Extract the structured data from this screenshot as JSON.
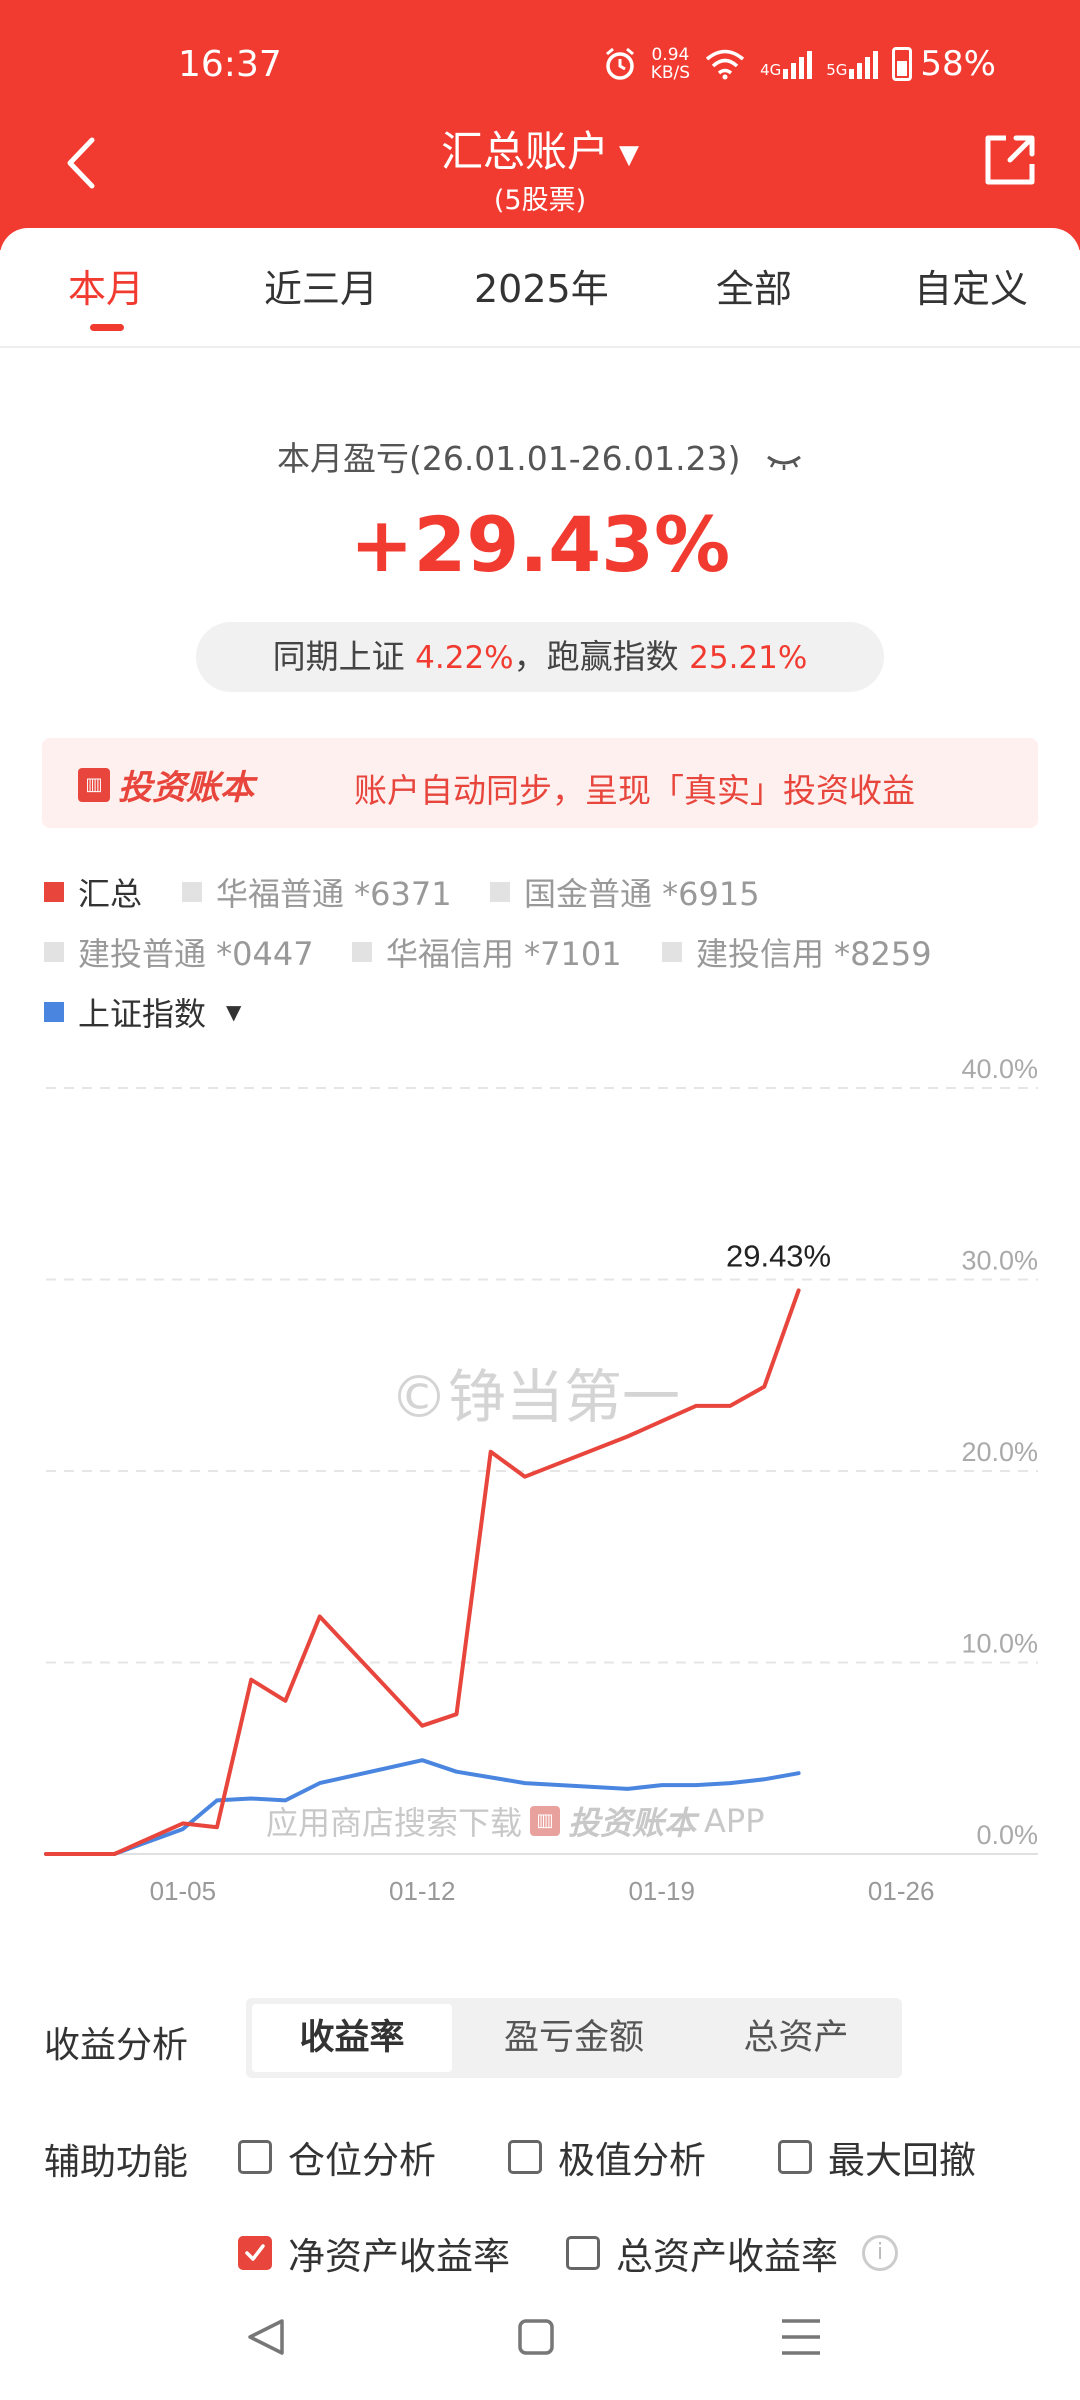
{
  "status": {
    "time": "16:37",
    "net_speed": "0.94",
    "net_unit": "KB/S",
    "sig1": "4G",
    "sig2": "5G",
    "battery": "58%"
  },
  "header": {
    "title": "汇总账户",
    "subtitle": "(5股票)"
  },
  "tabs": [
    "本月",
    "近三月",
    "2025年",
    "全部",
    "自定义"
  ],
  "summary": {
    "period": "本月盈亏(26.01.01-26.01.23)",
    "return": "+29.43%",
    "compare_prefix": "同期上证 ",
    "index_return": "4.22%",
    "compare_mid": "，跑赢指数 ",
    "beat_index": "25.21%"
  },
  "promo": {
    "logo_text": "投资账本",
    "text": "账户自动同步，呈现「真实」投资收益"
  },
  "legend": [
    {
      "label": "汇总",
      "color": "#e8453c",
      "active": true
    },
    {
      "label": "华福普通 *6371",
      "color": "#e2e2e2",
      "active": false
    },
    {
      "label": "国金普通 *6915",
      "color": "#e2e2e2",
      "active": false
    },
    {
      "label": "建投普通 *0447",
      "color": "#e2e2e2",
      "active": false
    },
    {
      "label": "华福信用 *7101",
      "color": "#e2e2e2",
      "active": false
    },
    {
      "label": "建投信用 *8259",
      "color": "#e2e2e2",
      "active": false
    },
    {
      "label": "上证指数",
      "color": "#4a86e0",
      "active": true
    }
  ],
  "chart_data": {
    "type": "line",
    "y_ticks": [
      "40.0%",
      "30.0%",
      "20.0%",
      "10.0%",
      "0.0%"
    ],
    "ylim": [
      0,
      40
    ],
    "x_ticks": [
      "01-05",
      "01-12",
      "01-19",
      "01-26"
    ],
    "x_tick_days": [
      5,
      12,
      19,
      26
    ],
    "xlim": [
      1,
      30
    ],
    "last_label": "29.43%",
    "grid": true,
    "series": [
      {
        "name": "汇总",
        "color": "#e8453c",
        "x": [
          1,
          3,
          5,
          6,
          7,
          8,
          9,
          12,
          13,
          14,
          15,
          18,
          19,
          20,
          21,
          22,
          23
        ],
        "y": [
          0.0,
          0.0,
          1.6,
          1.4,
          9.1,
          8.0,
          12.4,
          6.7,
          7.3,
          21.0,
          19.7,
          21.8,
          22.6,
          23.4,
          23.4,
          24.4,
          29.43
        ]
      },
      {
        "name": "上证指数",
        "color": "#4a86e0",
        "x": [
          1,
          3,
          5,
          6,
          7,
          8,
          9,
          12,
          13,
          14,
          15,
          18,
          19,
          20,
          21,
          22,
          23
        ],
        "y": [
          0.0,
          0.0,
          1.3,
          2.8,
          2.9,
          2.8,
          3.7,
          4.9,
          4.3,
          4.0,
          3.7,
          3.4,
          3.6,
          3.6,
          3.7,
          3.9,
          4.22
        ]
      }
    ]
  },
  "watermark": "©铮当第一",
  "app_watermark": {
    "prefix": "应用商店搜索下载",
    "logo": "投资账本",
    "suffix": "APP"
  },
  "analysis": {
    "label": "收益分析",
    "options": [
      "收益率",
      "盈亏金额",
      "总资产"
    ],
    "selected": "收益率"
  },
  "aux": {
    "label": "辅助功能",
    "items": [
      {
        "label": "仓位分析",
        "checked": false
      },
      {
        "label": "极值分析",
        "checked": false
      },
      {
        "label": "最大回撤",
        "checked": false
      },
      {
        "label": "净资产收益率",
        "checked": true
      },
      {
        "label": "总资产收益率",
        "checked": false
      }
    ]
  }
}
